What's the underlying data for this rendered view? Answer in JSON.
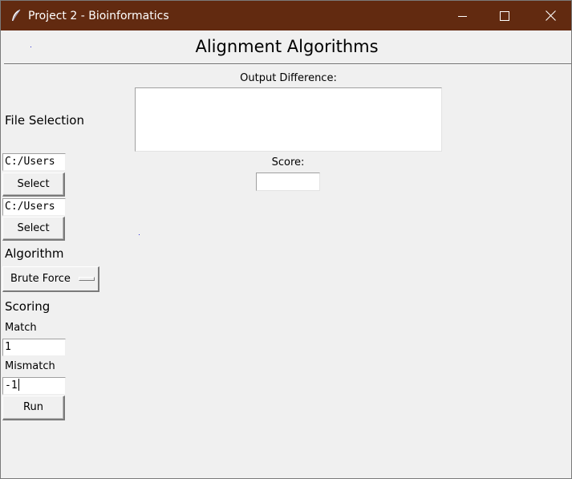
{
  "window": {
    "title": "Project 2 - Bioinformatics",
    "titlebar_color": "#622a10",
    "icons": {
      "app": "feather-icon",
      "minimize": "minimize-icon",
      "maximize": "maximize-icon",
      "close": "close-icon"
    }
  },
  "header": {
    "title": "Alignment Algorithms"
  },
  "output": {
    "label": "Output Difference:",
    "value": "",
    "score_label": "Score:",
    "score_value": ""
  },
  "sidebar": {
    "file_section_label": "File Selection",
    "file1": {
      "value": "C:/Users",
      "button": "Select"
    },
    "file2": {
      "value": "C:/Users",
      "button": "Select"
    },
    "algorithm_label": "Algorithm",
    "algorithm_selected": "Brute Force",
    "scoring_label": "Scoring",
    "match_label": "Match",
    "match_value": "1",
    "mismatch_label": "Mismatch",
    "mismatch_value": "-1",
    "run_button": "Run"
  }
}
